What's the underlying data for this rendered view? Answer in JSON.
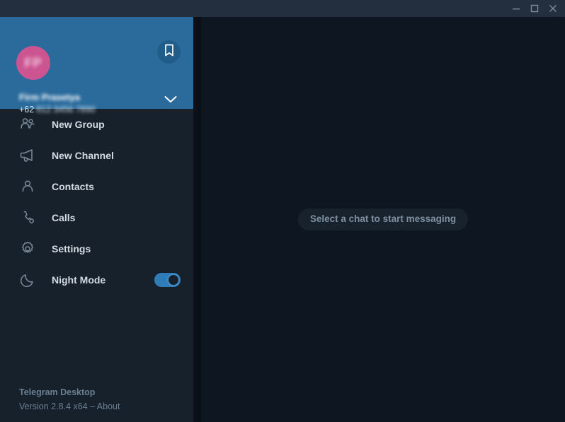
{
  "window": {
    "title": "Telegram Desktop",
    "controls": [
      {
        "name": "minimize",
        "glyph": "minimize-icon"
      },
      {
        "name": "maximize",
        "glyph": "maximize-icon"
      },
      {
        "name": "close",
        "glyph": "close-icon"
      }
    ]
  },
  "account": {
    "avatar_initials": "FP",
    "avatar_color": "#cc5490",
    "name": "Firm Prasetya",
    "name_redacted": true,
    "phone_prefix": "+62",
    "phone_digits": "812 3456 7890",
    "phone_redacted": true,
    "saved_messages_icon": "bookmark-icon",
    "expand_icon": "chevron-down-icon",
    "header_color": "#2a6b9c"
  },
  "menu": {
    "items": [
      {
        "label": "New Group",
        "icon": "users-icon",
        "toggle": null
      },
      {
        "label": "New Channel",
        "icon": "megaphone-icon",
        "toggle": null
      },
      {
        "label": "Contacts",
        "icon": "person-icon",
        "toggle": null
      },
      {
        "label": "Calls",
        "icon": "phone-icon",
        "toggle": null
      },
      {
        "label": "Settings",
        "icon": "gear-icon",
        "toggle": null
      },
      {
        "label": "Night Mode",
        "icon": "moon-icon",
        "toggle": "on"
      }
    ]
  },
  "footer": {
    "app_name": "Telegram Desktop",
    "version_line": "Version 2.8.4 x64 – About"
  },
  "main": {
    "empty_state": "Select a chat to start messaging"
  },
  "colors": {
    "titlebar": "#232f3e",
    "sidebar": "#17212b",
    "header_blue": "#2a6b9c",
    "chat_bg": "#0e1621",
    "accent": "#2f7cb8",
    "text_primary": "#d3dae1",
    "text_muted": "#6b7f92"
  }
}
